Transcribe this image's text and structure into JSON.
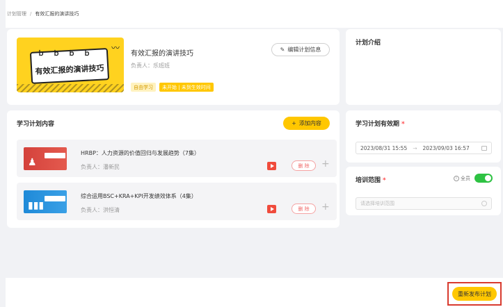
{
  "breadcrumb": {
    "parent": "计划管理",
    "separator": "/",
    "current": "有效汇报的演讲技巧"
  },
  "plan": {
    "cover_title": "有效汇报的演讲技巧",
    "title": "有效汇报的演讲技巧",
    "owner": "负责人：乐班班",
    "tags": [
      "自由学习",
      "未开始 | 未到生效时间"
    ],
    "edit_label": "编辑计划信息"
  },
  "intro": {
    "title": "计划介绍"
  },
  "content": {
    "title": "学习计划内容",
    "add_label": "添加内容",
    "courses": [
      {
        "name": "HRBP：人力资源的价值回归与发展趋势（7集）",
        "owner": "负责人：潘新民",
        "delete_label": "删 除"
      },
      {
        "name": "综合运用BSC+KRA+KPI开发绩效体系（4集）",
        "owner": "负责人：洪恒清",
        "delete_label": "删 除"
      }
    ]
  },
  "validity": {
    "title": "学习计划有效期",
    "required_mark": "*",
    "start": "2023/08/31 15:55",
    "arrow": "→",
    "end": "2023/09/03 16:57"
  },
  "scope": {
    "title": "培训范围",
    "required_mark": "*",
    "all_label": "全员",
    "toggle_on": true,
    "placeholder": "请选择培训范围"
  },
  "footer": {
    "publish_label": "重新发布计划"
  },
  "colors": {
    "accent": "#ffc700",
    "toggle": "#2ec243",
    "danger": "#f06a6a",
    "highlight_border": "#d83a2e"
  }
}
